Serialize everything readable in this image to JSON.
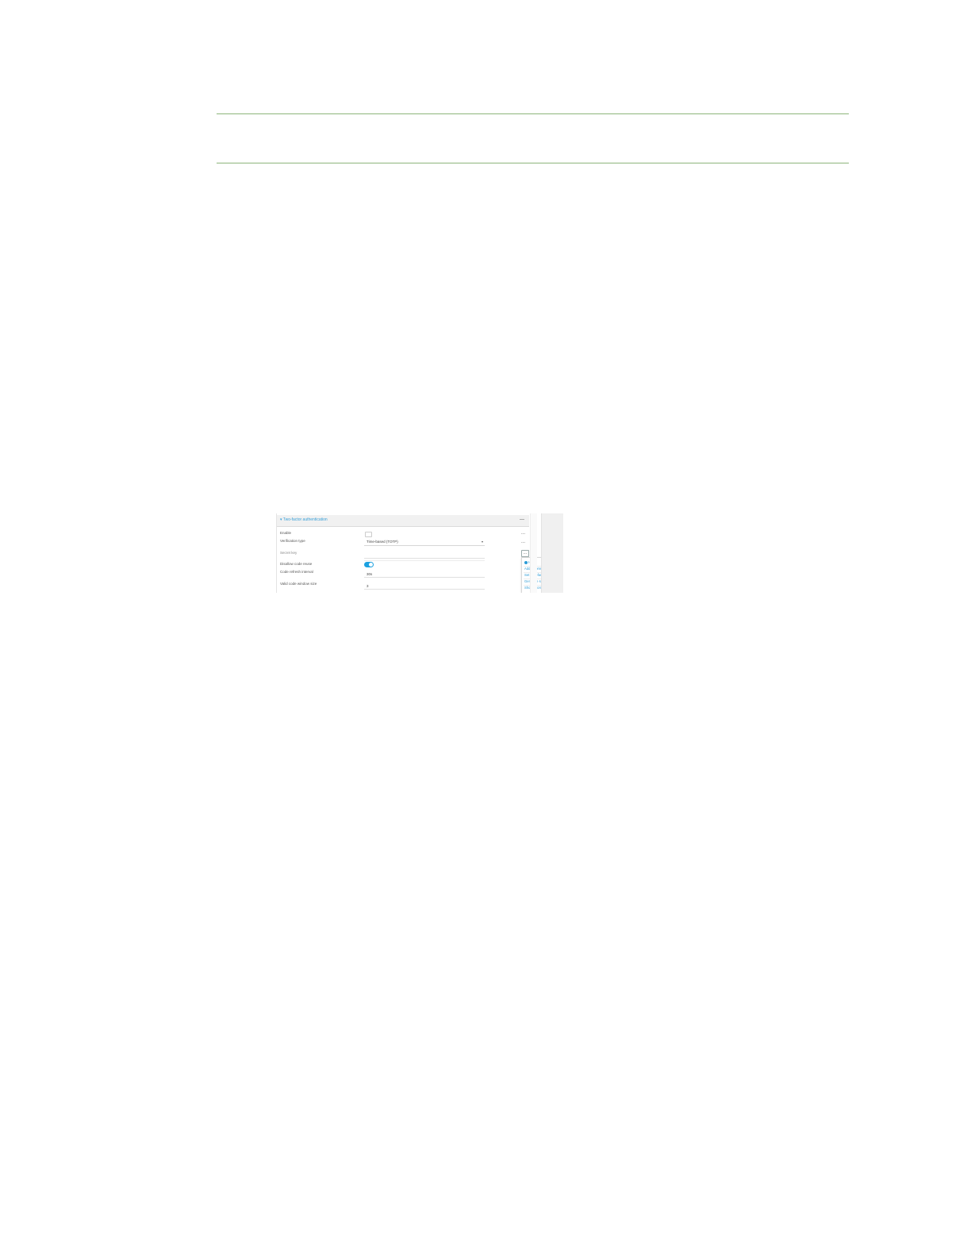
{
  "panel": {
    "title": "▾ Two-factor authentication",
    "collapse_symbol": "—"
  },
  "fields": {
    "enable_label": "Enable",
    "verification_type_label": "Verification type",
    "verification_type_value": "Time-based (TOTP)",
    "secret_key_label": "Secret key",
    "disallow_reuse_label": "Disallow code reuse",
    "refresh_interval_label": "Code refresh interval",
    "refresh_interval_value": "30s",
    "valid_window_label": "Valid code window size",
    "valid_window_value": "3"
  },
  "row_menu_symbol": "...",
  "menu": {
    "button_symbol": "...",
    "items": {
      "help": "Help",
      "add_comment": "Add a comment",
      "set_to_default": "Set to default",
      "generate_key": "Generate secret key",
      "show_qr_code": "Show secret key QR code"
    }
  },
  "icons": {
    "help": "help-circle-icon",
    "cursor": "hand-pointer-icon",
    "caret": "chevron-down-icon"
  },
  "colors": {
    "accent": "#1da1e0",
    "rule": "#8db57a"
  }
}
